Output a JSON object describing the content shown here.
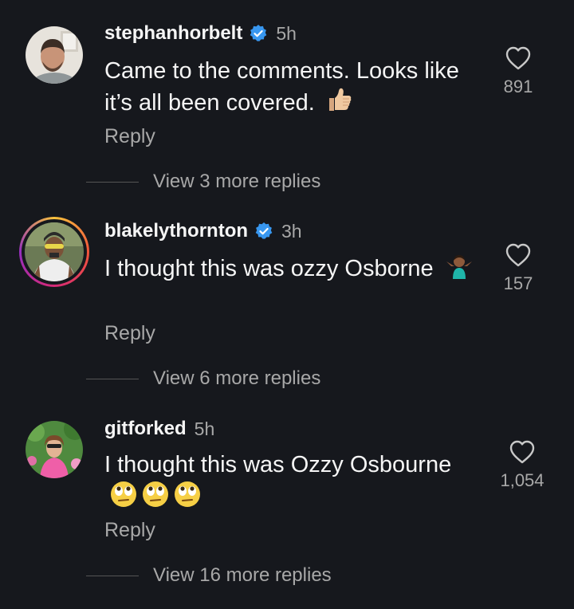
{
  "colors": {
    "background": "#16181d",
    "text": "#f5f5f5",
    "muted": "#a8a8a8",
    "verified": "#3897f0"
  },
  "comments": [
    {
      "username": "stephanhorbelt",
      "verified": true,
      "time": "5h",
      "text": "Came to the comments. Looks like it’s all been covered.",
      "emoji": "thumbs-up",
      "reply_label": "Reply",
      "likes": "891",
      "view_replies": "View 3 more replies",
      "has_story_ring": false
    },
    {
      "username": "blakelythornton",
      "verified": true,
      "time": "3h",
      "text": "I thought this was ozzy Osborne",
      "emoji": "person-shrugging",
      "reply_label": "Reply",
      "likes": "157",
      "view_replies": "View 6 more replies",
      "has_story_ring": true
    },
    {
      "username": "gitforked",
      "verified": false,
      "time": "5h",
      "text": "I thought this was Ozzy Osbourne",
      "emoji": "face-with-rolling-eyes x3",
      "reply_label": "Reply",
      "likes": "1,054",
      "view_replies": "View 16 more replies",
      "has_story_ring": false
    }
  ]
}
